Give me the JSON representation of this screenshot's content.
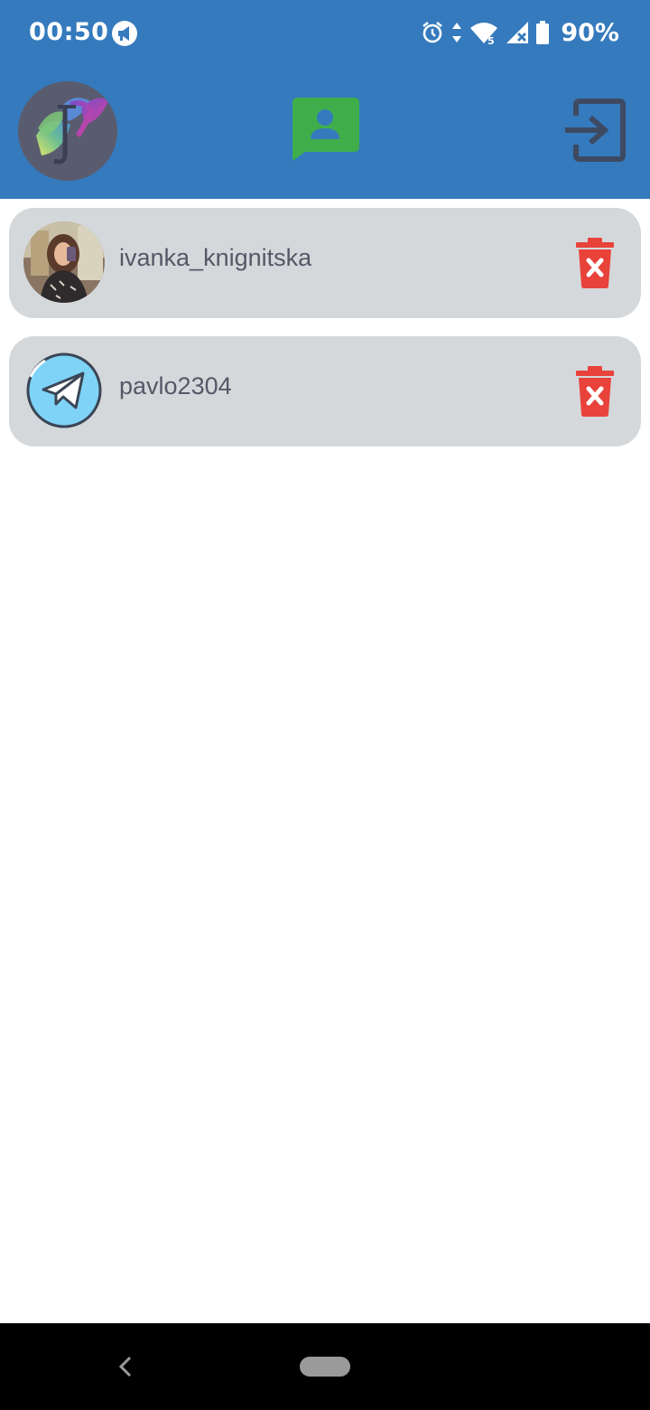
{
  "status_bar": {
    "time": "00:50",
    "battery": "90%",
    "network_label": "5"
  },
  "app_bar": {
    "logo_icon": "app-logo-icon",
    "chat_icon": "contact-chat-icon",
    "logout_icon": "logout-icon"
  },
  "accounts": [
    {
      "username": "ivanka_knignitska",
      "avatar": "photo-avatar"
    },
    {
      "username": "pavlo2304",
      "avatar": "telegram-avatar"
    }
  ],
  "colors": {
    "header": "#357ABD",
    "card": "#D5D8DB",
    "delete": "#E8423A",
    "chat_icon": "#3FAE4A",
    "logout_icon": "#3E4A62"
  }
}
